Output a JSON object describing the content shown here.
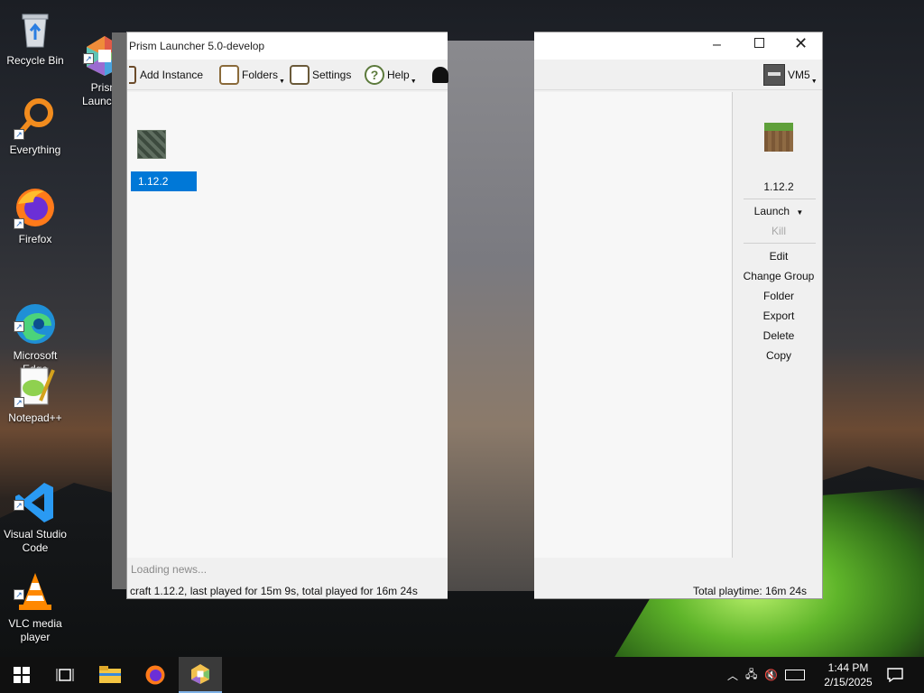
{
  "desktop": {
    "icons": [
      {
        "label": "Recycle Bin"
      },
      {
        "label": "Prism\nLauncher"
      },
      {
        "label": "Everything"
      },
      {
        "label": "Firefox"
      },
      {
        "label": "Microsoft\nEdge"
      },
      {
        "label": "Notepad++"
      },
      {
        "label": "Visual Studio\nCode"
      },
      {
        "label": "VLC media\nplayer"
      }
    ]
  },
  "window": {
    "title": "Prism Launcher 5.0-develop",
    "toolbar": {
      "add_instance": "Add Instance",
      "folders": "Folders",
      "settings": "Settings",
      "help": "Help"
    },
    "account": "VM5",
    "selected_instance": "1.12.2",
    "news": "Loading news...",
    "status_left": "craft 1.12.2, last played for 15m 9s, total played for 16m 24s",
    "status_right": "Total playtime: 16m 24s",
    "sidebar": {
      "instance_name": "1.12.2",
      "launch": "Launch",
      "kill": "Kill",
      "edit": "Edit",
      "change_group": "Change Group",
      "folder": "Folder",
      "export": "Export",
      "delete": "Delete",
      "copy": "Copy"
    }
  },
  "taskbar": {
    "time": "1:44 PM",
    "date": "2/15/2025"
  },
  "colors": {
    "selection": "#0078d7",
    "taskbar": "#101010"
  }
}
